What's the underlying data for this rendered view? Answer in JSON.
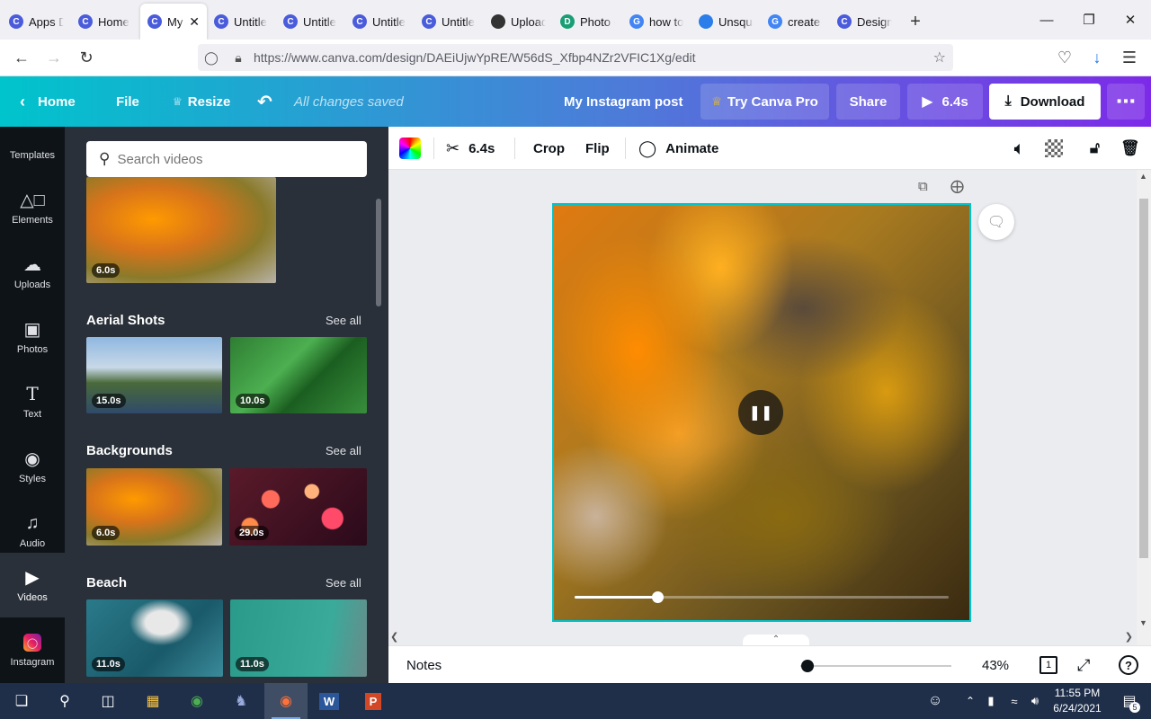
{
  "browser": {
    "tabs": [
      {
        "label": "Apps D",
        "icon": "canva-icon",
        "color": "#4a5cdb"
      },
      {
        "label": "Home",
        "icon": "canva-icon",
        "color": "#4a5cdb"
      },
      {
        "label": "My I",
        "icon": "canva-icon",
        "color": "#4a5cdb",
        "active": true
      },
      {
        "label": "Untitle",
        "icon": "canva-icon",
        "color": "#4a5cdb"
      },
      {
        "label": "Untitle",
        "icon": "canva-icon",
        "color": "#4a5cdb"
      },
      {
        "label": "Untitle",
        "icon": "canva-icon",
        "color": "#4a5cdb"
      },
      {
        "label": "Untitle",
        "icon": "canva-icon",
        "color": "#4a5cdb"
      },
      {
        "label": "Upload",
        "icon": "stack-icon",
        "color": "#333333"
      },
      {
        "label": "Photo c",
        "icon": "photo-icon",
        "color": "#1a9e75"
      },
      {
        "label": "how to",
        "icon": "google-icon",
        "color": "#4285f4"
      },
      {
        "label": "Unsqua",
        "icon": "unsquare-icon",
        "color": "#2b7de9"
      },
      {
        "label": "create a",
        "icon": "google-icon",
        "color": "#4285f4"
      },
      {
        "label": "Design",
        "icon": "canva-icon",
        "color": "#4a5cdb"
      }
    ],
    "url": "https://www.canva.com/design/DAEiUjwYpRE/W56dS_Xfbp4NZr2VFIC1Xg/edit"
  },
  "canva_bar": {
    "home": "Home",
    "file": "File",
    "resize": "Resize",
    "saved": "All changes saved",
    "design_title": "My Instagram post",
    "try_pro": "Try Canva Pro",
    "share": "Share",
    "play_duration": "6.4s",
    "download": "Download"
  },
  "rail": {
    "items": [
      {
        "label": "Templates"
      },
      {
        "label": "Elements"
      },
      {
        "label": "Uploads"
      },
      {
        "label": "Photos"
      },
      {
        "label": "Text"
      },
      {
        "label": "Styles"
      },
      {
        "label": "Audio"
      },
      {
        "label": "Videos",
        "active": true
      },
      {
        "label": "Instagram"
      }
    ]
  },
  "panel": {
    "search_placeholder": "Search videos",
    "top_thumb_duration": "6.0s",
    "sections": [
      {
        "title": "Aerial Shots",
        "see_all": "See all",
        "durations": [
          "15.0s",
          "10.0s"
        ]
      },
      {
        "title": "Backgrounds",
        "see_all": "See all",
        "durations": [
          "6.0s",
          "29.0s"
        ]
      },
      {
        "title": "Beach",
        "see_all": "See all",
        "durations": [
          "11.0s",
          "11.0s"
        ]
      }
    ]
  },
  "toolbar": {
    "duration": "6.4s",
    "crop": "Crop",
    "flip": "Flip",
    "animate": "Animate"
  },
  "player": {
    "progress": 0.22
  },
  "bottom": {
    "notes": "Notes",
    "zoom": "43%",
    "zoom_level": 0.05,
    "page": "1"
  },
  "taskbar": {
    "time": "11:55 PM",
    "date": "6/24/2021",
    "notifications": "5"
  },
  "colors": {
    "accent": "#00c4cc",
    "brand_purple": "#7d2ae8",
    "panel_bg": "#293039",
    "rail_bg": "#0e1318"
  }
}
